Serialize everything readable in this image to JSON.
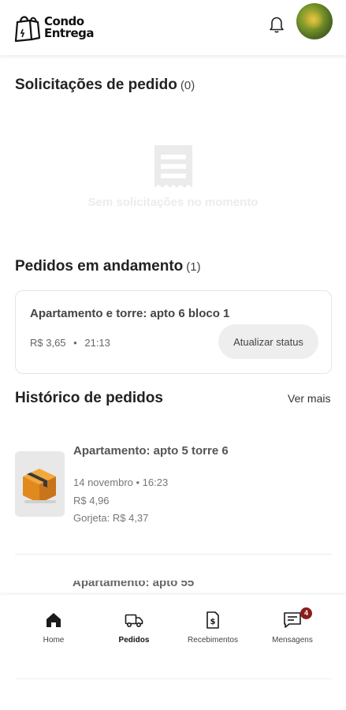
{
  "header": {
    "logo_line1": "Condo",
    "logo_line2": "Entrega",
    "bell_icon": "bell-icon",
    "avatar_icon": "user-avatar"
  },
  "requests": {
    "title": "Solicitações de pedido",
    "count": "(0)",
    "empty_icon": "receipt-icon",
    "empty_text": "Sem solicitações no momento"
  },
  "in_progress": {
    "title": "Pedidos em andamento",
    "count": "(1)",
    "orders": [
      {
        "title": "Apartamento e torre: apto 6 bloco 1",
        "price": "R$ 3,65",
        "separator": "•",
        "time": "21:13",
        "button": "Atualizar status"
      }
    ]
  },
  "history": {
    "title": "Histórico de pedidos",
    "see_more": "Ver mais",
    "items": [
      {
        "icon": "package-box-icon",
        "title": "Apartamento: apto 5 torre 6",
        "date_time": "14 novembro • 16:23",
        "price": "R$ 4,96",
        "tip": "Gorjeta: R$ 4,37"
      },
      {
        "title_partial": "Apartamento: apto 55"
      }
    ]
  },
  "nav": {
    "items": [
      {
        "label": "Home",
        "icon": "home-icon",
        "active": false
      },
      {
        "label": "Pedidos",
        "icon": "truck-icon",
        "active": true
      },
      {
        "label": "Recebimentos",
        "icon": "money-document-icon",
        "active": false
      },
      {
        "label": "Mensagens",
        "icon": "message-icon",
        "active": false,
        "badge": "4"
      }
    ]
  },
  "colors": {
    "badge": "#8a1d1d",
    "button_bg": "#eeeeee",
    "empty_text": "#ececec"
  }
}
